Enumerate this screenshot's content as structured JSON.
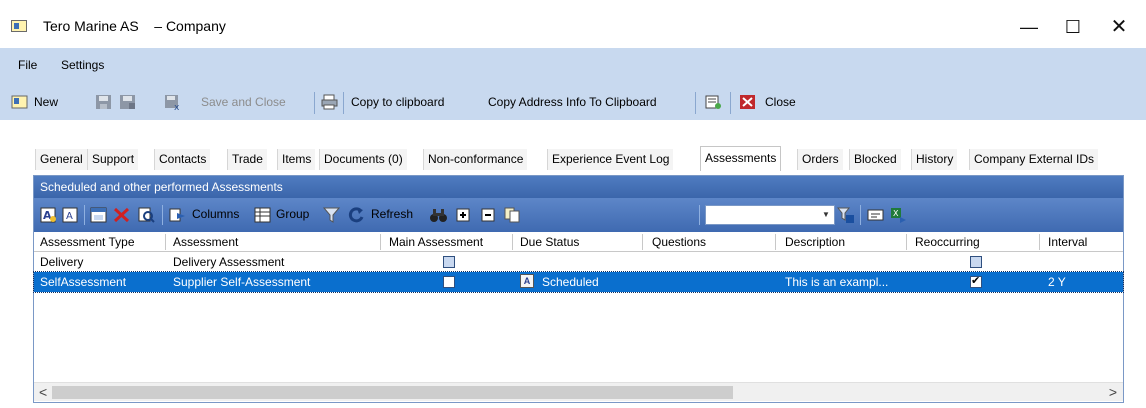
{
  "window": {
    "title": "Tero Marine AS    – Company",
    "minimize": "—",
    "maximize": "☐",
    "close": "✕"
  },
  "menu": {
    "file": "File",
    "settings": "Settings"
  },
  "toolbar": {
    "new": "New",
    "save_and_close": "Save and Close",
    "copy_to_clipboard": "Copy to clipboard",
    "copy_address": "Copy Address Info To Clipboard",
    "close": "Close"
  },
  "tabs": [
    "General",
    "Support",
    "Contacts",
    "Trade",
    "Items",
    "Documents (0)",
    "Non-conformance",
    "Experience Event Log",
    "Assessments",
    "Orders",
    "Blocked",
    "History",
    "Company External IDs"
  ],
  "active_tab": "Assessments",
  "panel": {
    "header": "Scheduled and other performed Assessments",
    "toolbar": {
      "columns": "Columns",
      "group": "Group",
      "refresh": "Refresh",
      "combo_value": ""
    }
  },
  "grid": {
    "columns": [
      "Assessment Type",
      "Assessment",
      "Main Assessment",
      "Due Status",
      "Questions",
      "Description",
      "Reoccurring",
      "Interval"
    ],
    "rows": [
      {
        "type": "Delivery",
        "assessment": "Delivery Assessment",
        "main": false,
        "due_status": "",
        "questions": "",
        "description": "",
        "reoccurring": false,
        "interval": ""
      },
      {
        "type": "SelfAssessment",
        "assessment": "Supplier Self-Assessment",
        "main": false,
        "due_status": "Scheduled",
        "questions": "",
        "description": "This is an exampl...",
        "reoccurring": true,
        "interval": "2 Y",
        "selected": true
      }
    ],
    "scroll_left": "<",
    "scroll_right": ">"
  },
  "colors": {
    "menubar": "#c8d9ef",
    "panel_header": "#3b66ab",
    "selection": "#0a6fce",
    "close_red": "#c0282c"
  },
  "icons": [
    "app-icon",
    "save-icon",
    "print-icon",
    "notes-icon",
    "close-x-icon",
    "filter-icon",
    "refresh-icon",
    "binoculars-icon",
    "plus-icon",
    "minus-icon",
    "copy-icon",
    "excel-export-icon"
  ]
}
